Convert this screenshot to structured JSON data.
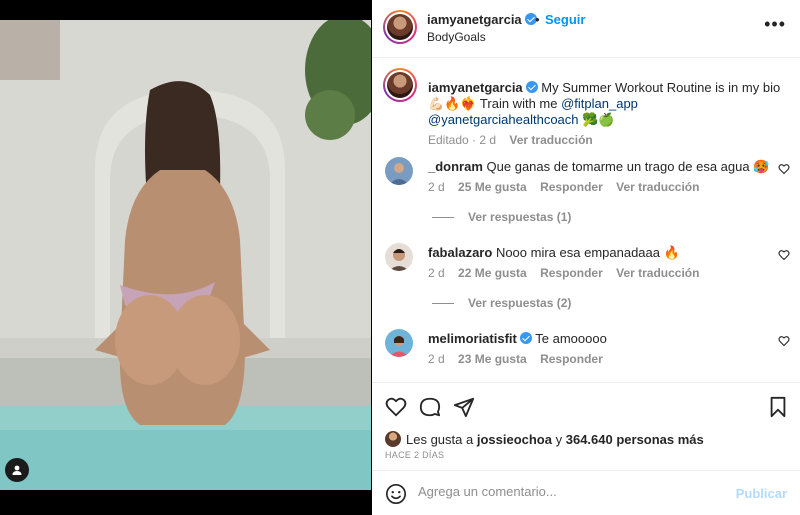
{
  "header": {
    "username": "iamyanetgarcia",
    "location": "BodyGoals",
    "separator": "•",
    "follow_label": "Seguir",
    "more_label": "•••"
  },
  "caption": {
    "username": "iamyanetgarcia",
    "text_1": "My Summer Workout Routine is in my bio",
    "text_2": "💪🏻🔥❤️‍🔥 Train with me",
    "mention_1": "@fitplan_app",
    "mention_2": "@yanetgarciahealthcoach",
    "text_3": "🥦🍏",
    "edited": "Editado · 2 d",
    "translate": "Ver traducción"
  },
  "comments": [
    {
      "username": "_donram",
      "text": "Que ganas de tomarme un trago de esa agua 🥵",
      "age": "2 d",
      "likes": "25 Me gusta",
      "reply": "Responder",
      "translate": "Ver traducción",
      "replies": "Ver respuestas (1)"
    },
    {
      "username": "fabalazaro",
      "text": "Nooo mira esa empanadaaa 🔥",
      "age": "2 d",
      "likes": "22 Me gusta",
      "reply": "Responder",
      "translate": "Ver traducción",
      "replies": "Ver respuestas (2)"
    },
    {
      "username": "melimoriatisfit",
      "text": "Te amooooo",
      "age": "2 d",
      "likes": "23 Me gusta",
      "reply": "Responder"
    }
  ],
  "likes": {
    "prefix": "Les gusta a",
    "user": "jossieochoa",
    "joiner": "y",
    "count": "364.640 personas más"
  },
  "time_ago": "HACE 2 DÍAS",
  "add_comment": {
    "placeholder": "Agrega un comentario...",
    "publish_label": "Publicar"
  },
  "icons": {
    "like": "heart-icon",
    "comment": "comment-icon",
    "share": "share-icon",
    "save": "bookmark-icon",
    "emoji": "emoji-icon",
    "tagged": "user-tag-icon"
  },
  "colors": {
    "accent": "#0095f6",
    "link": "#00376b",
    "verified": "#3897f0",
    "muted": "#8e8e8e",
    "publish_disabled": "#b3dbff"
  }
}
